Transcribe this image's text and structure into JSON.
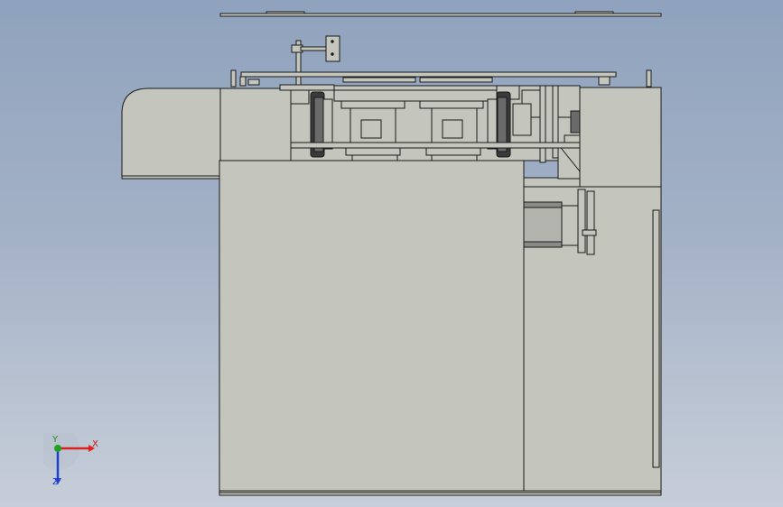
{
  "viewport": {
    "background_top": "#8fa2bd",
    "background_bottom": "#c7ced9",
    "part_fill": "#c4c5bd",
    "part_stroke": "#1a1a1a",
    "dark_part": "#3a3a3a"
  },
  "triad": {
    "x_label": "X",
    "y_label": "Y",
    "z_label": "Z",
    "x_color": "#e01f1f",
    "y_color": "#1fa01f",
    "z_color": "#1f3fd0"
  }
}
